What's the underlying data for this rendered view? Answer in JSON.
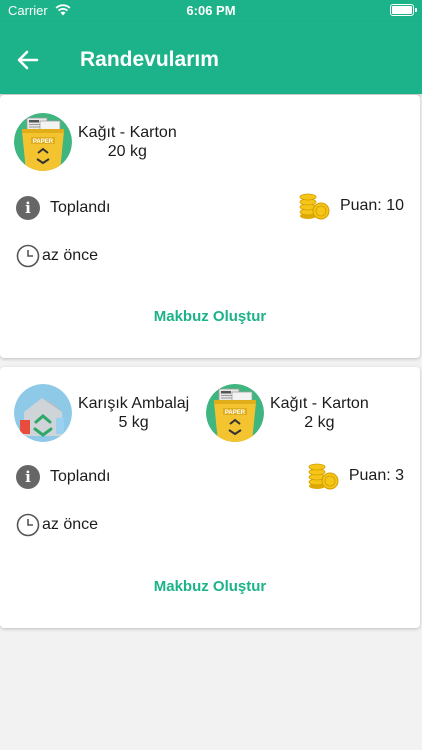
{
  "status_bar": {
    "carrier": "Carrier",
    "time": "6:06 PM",
    "battery_level": 1.0
  },
  "header": {
    "title": "Randevularım",
    "back_icon": "arrow-left-icon"
  },
  "appointments": [
    {
      "items": [
        {
          "name": "Kağıt - Karton",
          "weight": "20 kg",
          "icon": "paper-recycle-icon"
        }
      ],
      "status": "Toplandı",
      "points": "Puan: 10",
      "time": "az önce",
      "receipt_button": "Makbuz Oluştur"
    },
    {
      "items": [
        {
          "name": "Karışık Ambalaj",
          "weight": "5 kg",
          "icon": "packaging-recycle-icon"
        },
        {
          "name": "Kağıt - Karton",
          "weight": "2 kg",
          "icon": "paper-recycle-icon"
        }
      ],
      "status": "Toplandı",
      "points": "Puan: 3",
      "time": "az önce",
      "receipt_button": "Makbuz Oluştur"
    }
  ],
  "colors": {
    "primary": "#1db38a",
    "info_icon": "#666666",
    "coin": "#f5c518"
  }
}
